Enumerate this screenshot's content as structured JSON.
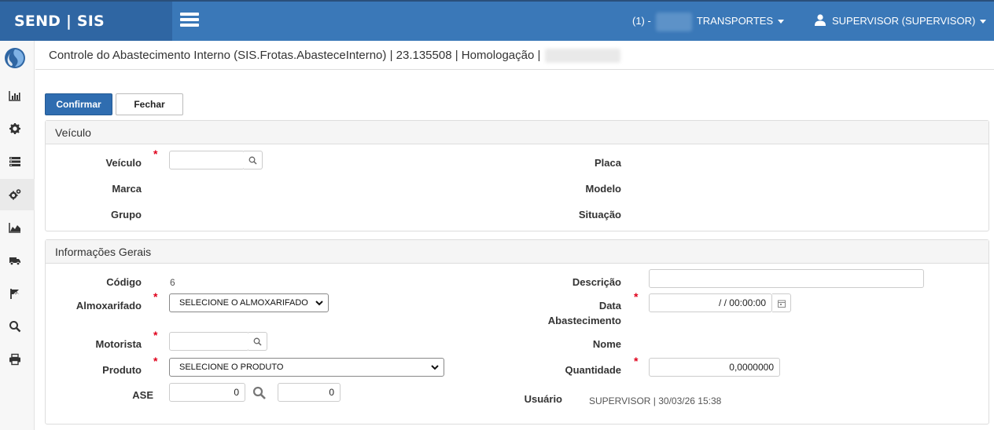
{
  "header": {
    "brand": "SEND | SIS",
    "company_prefix": "(1) -",
    "company_name": "TRANSPORTES",
    "user": "SUPERVISOR (SUPERVISOR)"
  },
  "breadcrumb": {
    "title": "Controle do Abastecimento Interno (SIS.Frotas.AbasteceInterno) | 23.135508 | Homologação |"
  },
  "toolbar": {
    "confirm_label": "Confirmar",
    "close_label": "Fechar"
  },
  "veiculo_panel": {
    "title": "Veículo",
    "veiculo_label": "Veículo",
    "placa_label": "Placa",
    "marca_label": "Marca",
    "modelo_label": "Modelo",
    "grupo_label": "Grupo",
    "situacao_label": "Situação",
    "veiculo_value": ""
  },
  "info_panel": {
    "title": "Informações Gerais",
    "codigo_label": "Código",
    "codigo_value": "6",
    "descricao_label": "Descrição",
    "descricao_value": "",
    "almox_label": "Almoxarifado",
    "almox_value": "SELECIONE O ALMOXARIFADO",
    "data_label_1": "Data",
    "data_label_2": "Abastecimento",
    "data_value": "/ /     00:00:00",
    "motorista_label": "Motorista",
    "motorista_value": "",
    "nome_label": "Nome",
    "produto_label": "Produto",
    "produto_value": "SELECIONE O PRODUTO",
    "quantidade_label": "Quantidade",
    "quantidade_value": "0,0000000",
    "ase_label": "ASE",
    "ase_value_1": "0",
    "ase_value_2": "0",
    "usuario_label": "Usuário",
    "usuario_value": "SUPERVISOR | 30/03/26 15:38"
  },
  "colors": {
    "topbar": "#3a78b8",
    "brand_bg": "#2f66a3",
    "primary_button": "#2f6db0",
    "required": "#e0001b"
  },
  "icons": {
    "sidebar": [
      "logo-icon",
      "bar-chart-icon",
      "gear-icon",
      "list-icon",
      "gears-icon",
      "area-chart-icon",
      "truck-icon",
      "flag-icon",
      "search-icon",
      "print-icon"
    ]
  }
}
